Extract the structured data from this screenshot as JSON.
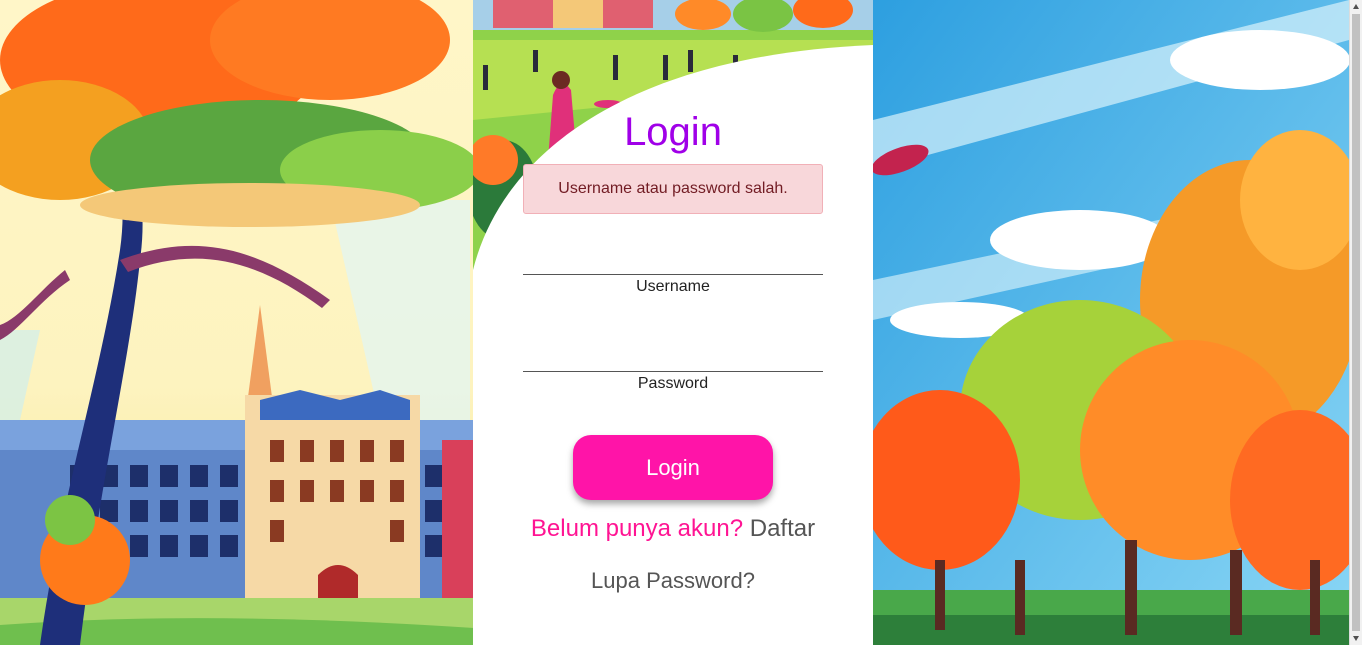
{
  "login": {
    "title": "Login",
    "error_message": "Username atau password salah.",
    "username_label": "Username",
    "username_value": "",
    "password_label": "Password",
    "password_value": "",
    "submit_label": "Login",
    "register_prompt": "Belum punya akun?",
    "register_link": "Daftar",
    "forgot_link": "Lupa Password?"
  },
  "colors": {
    "title": "#a000e8",
    "button": "#ff14a8",
    "prompt": "#ff1493",
    "link": "#555555",
    "alert_bg": "#f8d7da",
    "alert_text": "#721c24"
  }
}
